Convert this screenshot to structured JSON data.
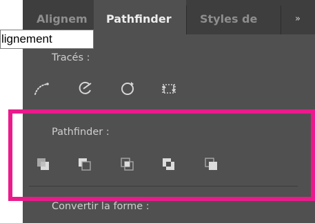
{
  "tabs": [
    {
      "label": "Alignem",
      "active": false
    },
    {
      "label": "Pathfinder",
      "active": true
    },
    {
      "label": "Styles de",
      "active": false
    }
  ],
  "tab_overflow": {
    "label": "»",
    "icon": "double-chevron-right-icon"
  },
  "tooltip": {
    "text": "lignement"
  },
  "sections": {
    "traces": {
      "label": "Tracés :",
      "icons": [
        "dotted-curve-path-icon",
        "circle-cut-icon",
        "dashed-circle-arrow-icon",
        "swap-corners-icon"
      ]
    },
    "pathfinder": {
      "label": "Pathfinder :",
      "icons": [
        "unite-icon",
        "minus-front-icon",
        "intersect-icon",
        "exclude-icon",
        "divide-corner-icon"
      ]
    },
    "convert": {
      "label": "Convertir la forme :"
    }
  },
  "colors": {
    "panel": "#505050",
    "tabbar": "#3e3e3e",
    "highlight": "#ea1a8c",
    "label": "#cfcfcf"
  }
}
